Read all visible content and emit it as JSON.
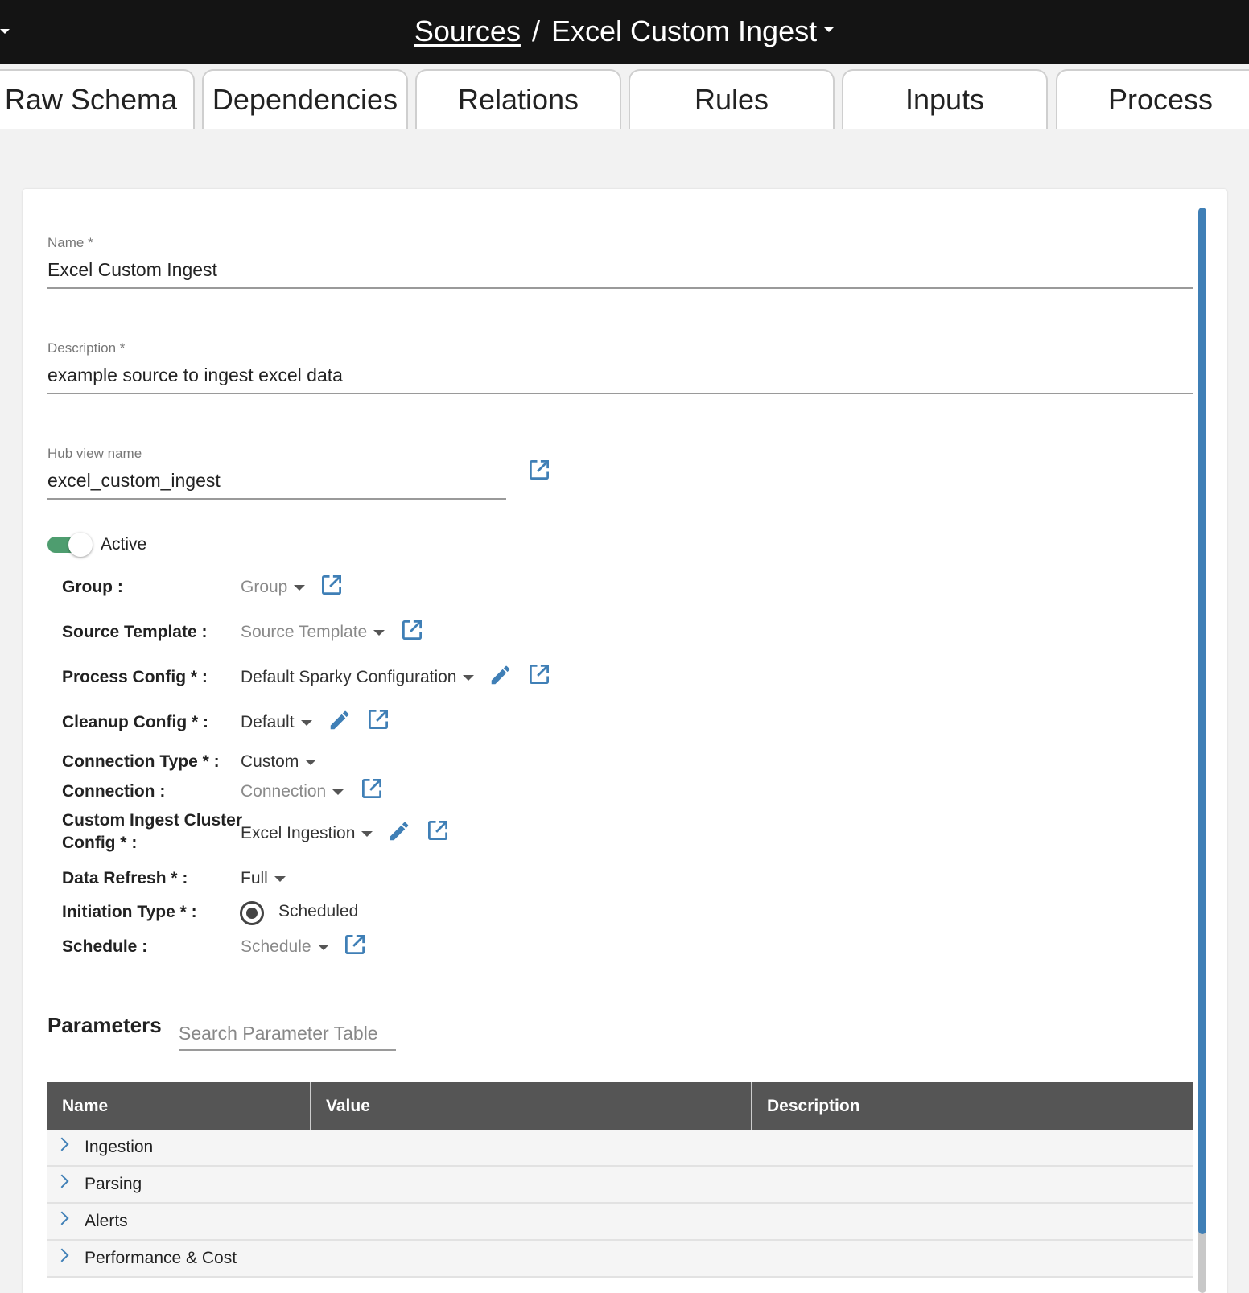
{
  "header": {
    "breadcrumb_root": "Sources",
    "separator": "/",
    "title": "Excel Custom Ingest"
  },
  "tabs": [
    {
      "label": "Raw Schema"
    },
    {
      "label": "Dependencies"
    },
    {
      "label": "Relations"
    },
    {
      "label": "Rules"
    },
    {
      "label": "Inputs"
    },
    {
      "label": "Process"
    }
  ],
  "form": {
    "name": {
      "label": "Name *",
      "value": "Excel Custom Ingest"
    },
    "description": {
      "label": "Description *",
      "value": "example source to ingest excel data"
    },
    "hub_view": {
      "label": "Hub view name",
      "value": "excel_custom_ingest"
    },
    "active": {
      "label": "Active",
      "on": true
    },
    "rows": {
      "group": {
        "label": "Group :",
        "value": "Group"
      },
      "source_template": {
        "label": "Source Template :",
        "value": "Source Template"
      },
      "process_config": {
        "label": "Process Config * :",
        "value": "Default Sparky Configuration"
      },
      "cleanup_config": {
        "label": "Cleanup Config * :",
        "value": "Default"
      },
      "connection_type": {
        "label": "Connection Type * :",
        "value": "Custom"
      },
      "connection": {
        "label": "Connection :",
        "value": "Connection"
      },
      "custom_ingest_cluster_config": {
        "label_line1": "Custom Ingest Cluster",
        "label_line2": "Config * :",
        "value": "Excel Ingestion"
      },
      "data_refresh": {
        "label": "Data Refresh * :",
        "value": "Full"
      },
      "initiation_type": {
        "label": "Initiation Type * :",
        "value": "Scheduled"
      },
      "schedule": {
        "label": "Schedule :",
        "value": "Schedule"
      }
    }
  },
  "parameters": {
    "title": "Parameters",
    "search_placeholder": "Search Parameter Table",
    "columns": [
      "Name",
      "Value",
      "Description"
    ],
    "rows": [
      "Ingestion",
      "Parsing",
      "Alerts",
      "Performance & Cost"
    ]
  },
  "colors": {
    "accent": "#3f7fb6",
    "toggle_on": "#4e9d6f",
    "header_bg": "#141414",
    "table_header_bg": "#555555"
  },
  "icons": {
    "open_external": "external-link-icon",
    "edit": "pencil-icon",
    "expand": "chevron-right-icon",
    "dropdown": "caret-down-icon"
  }
}
